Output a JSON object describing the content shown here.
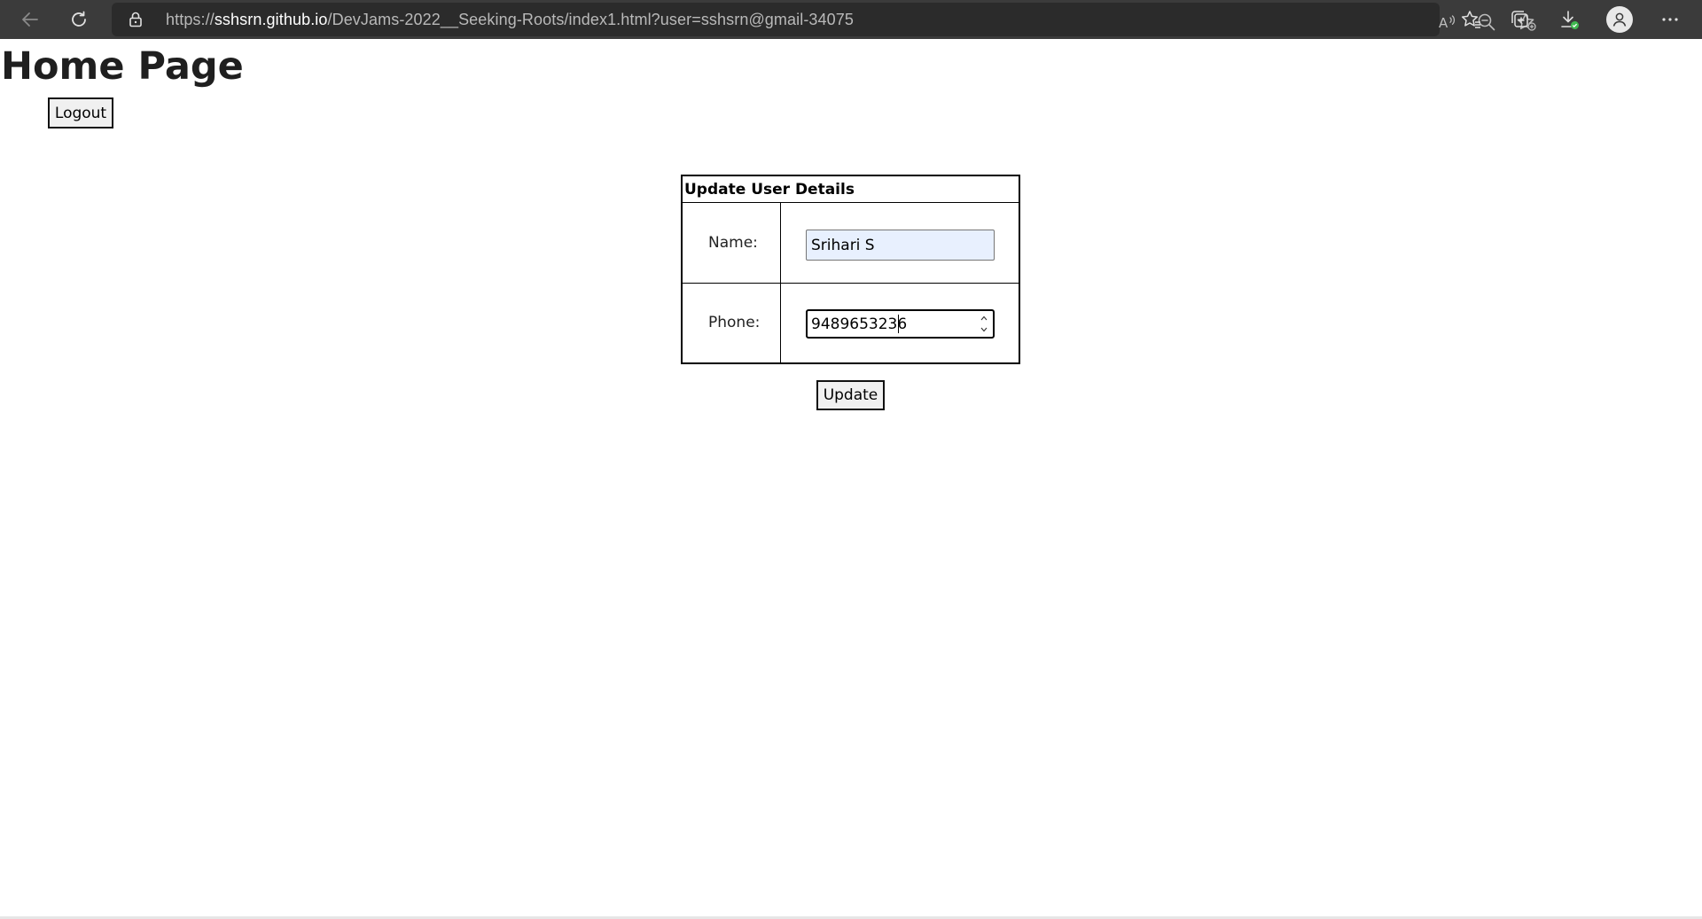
{
  "browser": {
    "url_scheme": "https://",
    "url_host": "sshsrn.github.io",
    "url_path": "/DevJams-2022__Seeking-Roots/index1.html?user=sshsrn@gmail-34075",
    "icons": {
      "back": "back-arrow-icon",
      "reload": "reload-icon",
      "lock": "lock-icon",
      "read_aloud": "read-aloud-icon",
      "zoom_out": "zoom-out-icon",
      "add_favorite": "add-favorite-icon",
      "favorites": "favorites-icon",
      "collections": "collections-icon",
      "downloads": "downloads-icon",
      "profile": "profile-icon",
      "more": "more-icon"
    },
    "colors": {
      "toolbar": "#3b3b3b",
      "address_bar": "#2b2b2b"
    }
  },
  "page": {
    "title": "Home Page",
    "logout_label": "Logout",
    "form": {
      "caption": "Update User Details",
      "name_label": "Name:",
      "name_value": "Srihari S",
      "phone_label": "Phone:",
      "phone_value": "9489653236",
      "update_label": "Update"
    },
    "colors": {
      "autofill_background": "#e8f0fe"
    }
  }
}
